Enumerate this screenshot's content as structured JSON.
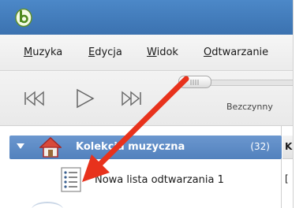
{
  "menubar": {
    "items": [
      {
        "label": "Muzyka"
      },
      {
        "label": "Edycja"
      },
      {
        "label": "Widok"
      },
      {
        "label": "Odtwarzanie"
      }
    ]
  },
  "toolbar": {
    "previous_icon": "skip-previous-icon",
    "play_icon": "play-icon",
    "next_icon": "skip-next-icon",
    "status": "Bezczynny"
  },
  "sidebar": {
    "collection": {
      "label": "Kolekcja muzyczna",
      "count": "(32)",
      "icon": "home-icon"
    },
    "playlist": {
      "label": "Nowa lista odtwarzania 1",
      "icon": "playlist-icon"
    }
  },
  "right_pane": {
    "header_fragment": "K",
    "row_fragment": "["
  },
  "colors": {
    "titlebar": "#4c88c8",
    "selection": "#5a89c4",
    "annotation_arrow": "#e8321c"
  }
}
